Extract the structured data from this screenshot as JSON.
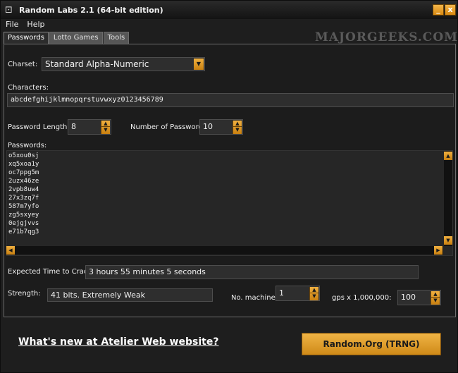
{
  "window": {
    "title": "Random Labs 2.1 (64-bit edition)",
    "minimize_glyph": "_",
    "close_glyph": "x",
    "app_icon": "dice-icon"
  },
  "menu": {
    "items": [
      "File",
      "Help"
    ]
  },
  "tabs": [
    {
      "label": "Passwords",
      "active": true
    },
    {
      "label": "Lotto Games",
      "active": false
    },
    {
      "label": "Tools",
      "active": false
    }
  ],
  "watermark": "MAJORGEEKS.COM",
  "charset": {
    "label": "Charset:",
    "value": "Standard Alpha-Numeric"
  },
  "characters": {
    "label": "Characters:",
    "value": "abcdefghijklmnopqrstuvwxyz0123456789"
  },
  "password_length": {
    "label": "Password Length:",
    "value": "8"
  },
  "number_of_passwords": {
    "label": "Number of Passwords:",
    "value": "10"
  },
  "passwords": {
    "label": "Passwords:",
    "items": [
      "o5xou0sj",
      "xq5xoa1y",
      "oc7ppg5m",
      "2uzx46ze",
      "2vpb8uw4",
      "27x3zq7f",
      "587m7yfo",
      "zg5sxyey",
      "0ejgjvvs",
      "e71b7qg3"
    ]
  },
  "expected_time": {
    "label": "Expected Time to Crack:",
    "value": "3 hours 55 minutes 5 seconds"
  },
  "strength": {
    "label": "Strength:",
    "value": "41 bits. Extremely Weak"
  },
  "machines": {
    "label": "No. machines:",
    "value": "1"
  },
  "gps": {
    "label": "gps x 1,000,000:",
    "value": "100"
  },
  "footer": {
    "link_text": "What's new at Atelier Web website?",
    "button_label": "Random.Org (TRNG)"
  },
  "colors": {
    "accent": "#e9a331",
    "background": "#1e1e1e",
    "field": "#2e2e2e"
  }
}
